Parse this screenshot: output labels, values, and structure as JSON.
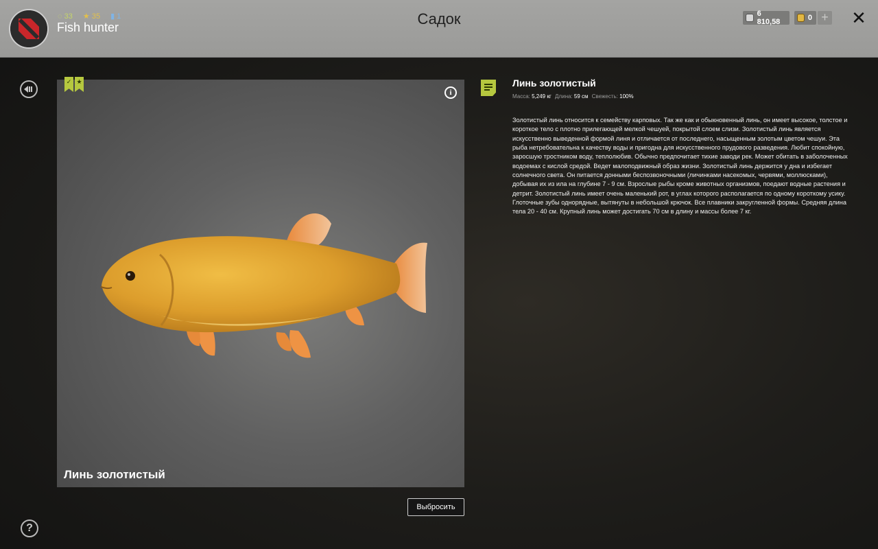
{
  "header": {
    "title": "Садок",
    "username": "Fish hunter",
    "stats": {
      "a": "33",
      "b": "35",
      "c": "1"
    },
    "silver": "6 810,58",
    "gold": "0",
    "plus": "+",
    "close": "✕"
  },
  "fish": {
    "name": "Линь золотистый",
    "badge_check": "✓",
    "badge_star": "★",
    "info": "i",
    "discard_label": "Выбросить"
  },
  "details": {
    "title": "Линь золотистый",
    "mass_label": "Масса:",
    "mass_value": "5,249 кг",
    "length_label": "Длина:",
    "length_value": "59 см",
    "fresh_label": "Свежесть:",
    "fresh_value": "100%",
    "description": "Золотистый линь относится к семейству карповых. Так же как и обыкновенный линь, он имеет высокое, толстое и короткое тело с плотно прилегающей мелкой чешуей, покрытой слоем слизи. Золотистый линь является искусственно выведенной формой линя и отличается от последнего, насыщенным золотым цветом чешуи. Эта рыба нетребовательна к качеству воды и пригодна для искусственного прудового разведения. Любит спокойную, заросшую тростником воду, теплолюбив. Обычно предпочитает тихие заводи рек. Может обитать в заболоченных водоемах с кислой средой. Ведет малоподвижный образ жизни. Золотистый линь держится у дна и избегает солнечного света. Он питается донными беспозвоночными (личинками насекомых, червями, моллюсками), добывая их из ила на глубине 7 - 9 см. Взрослые рыбы кроме животных организмов, поедают водные растения и детрит. Золотистый линь имеет очень маленький рот, в углах которого располагается по одному короткому усику. Глоточные зубы однорядные, вытянуты в небольшой крючок. Все плавники закругленной формы. Средняя длина тела 20 - 40 см. Крупный линь может достигать 70 см в длину и массы более 7 кг."
  },
  "help": "?",
  "icons": [
    "dota-avatar-icon",
    "silver-coin-icon",
    "gold-coin-icon",
    "back-arrow-icon",
    "help-icon",
    "note-icon",
    "info-icon",
    "close-icon"
  ],
  "colors": {
    "accent": "#b6c83f",
    "header": "#9d9d9b",
    "fish_body": "#e0a432"
  }
}
